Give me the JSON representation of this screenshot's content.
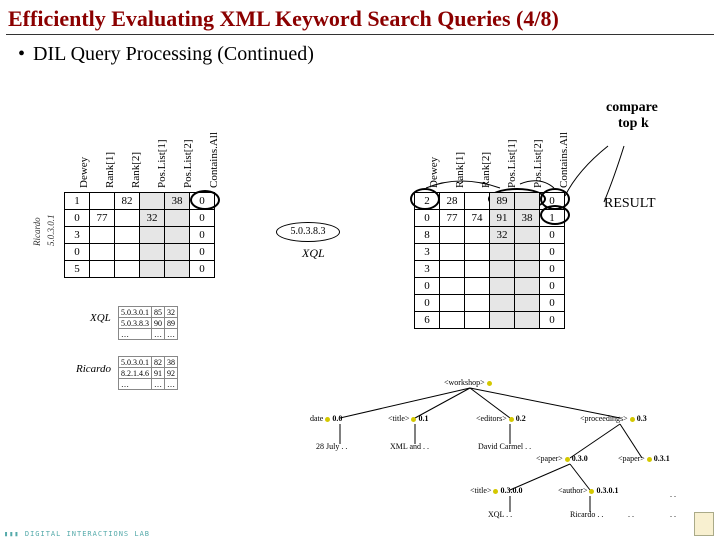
{
  "title": "Efficiently Evaluating XML Keyword Search Queries (4/8)",
  "bullet": "DIL Query Processing (Continued)",
  "headers": [
    "Dewey",
    "Rank[1]",
    "Rank[2]",
    "Pos.List[1]",
    "Pos.List[2]",
    "Contains.All"
  ],
  "right_labels": {
    "compare": "compare",
    "topk": "top k",
    "result": "RESULT"
  },
  "left_table": {
    "rows": [
      [
        "1",
        "",
        "82",
        "",
        "38",
        "0"
      ],
      [
        "0",
        "77",
        "",
        "32",
        "",
        "0"
      ],
      [
        "3",
        "",
        "",
        "",
        "",
        "0"
      ],
      [
        "0",
        "",
        "",
        "",
        "",
        "0"
      ],
      [
        "5",
        "",
        "",
        "",
        "",
        "0"
      ]
    ],
    "shaded_cols": [
      3,
      4
    ]
  },
  "right_table": {
    "rows": [
      [
        "2",
        "28",
        "",
        "89",
        "",
        "0"
      ],
      [
        "0",
        "77",
        "74",
        "91",
        "38",
        "1"
      ],
      [
        "8",
        "",
        "",
        "32",
        "",
        "0"
      ],
      [
        "3",
        "",
        "",
        "",
        "",
        "0"
      ],
      [
        "3",
        "",
        "",
        "",
        "",
        "0"
      ],
      [
        "0",
        "",
        "",
        "",
        "",
        "0"
      ],
      [
        "0",
        "",
        "",
        "",
        "",
        "0"
      ],
      [
        "6",
        "",
        "",
        "",
        "",
        "0"
      ]
    ],
    "shaded_cols": [
      3,
      4
    ]
  },
  "mid_oval": "5.0.3.8.3",
  "mid_label": "XQL",
  "side_labels": {
    "num": "5.0.3.0.1",
    "name": "Ricardo"
  },
  "mini_tables": {
    "xql": {
      "caption": "XQL",
      "rows": [
        [
          "5.0.3.0.1",
          "85",
          "32"
        ],
        [
          "5.0.3.8.3",
          "90",
          "89"
        ],
        [
          "…",
          "…",
          "…"
        ]
      ]
    },
    "ricardo": {
      "caption": "Ricardo",
      "rows": [
        [
          "5.0.3.0.1",
          "82",
          "38"
        ],
        [
          "8.2.1.4.6",
          "91",
          "92"
        ],
        [
          "…",
          "…",
          "…"
        ]
      ]
    }
  },
  "tree": {
    "root": "<workshop>",
    "n_date_l": "date",
    "n_date_v": "0.0",
    "n_title1": "<title>",
    "n_title1_v": "0.1",
    "n_editors": "<editors>",
    "n_editors_v": "0.2",
    "n_proc": "<proceedings>",
    "n_proc_v": "0.3",
    "n_28july": "28 July . .",
    "n_xmland": "XML and . .",
    "n_david": "David Carmel . .",
    "n_paper1": "<paper>",
    "n_paper1_v": "0.3.0",
    "n_paper2": "<paper>",
    "n_paper2_v": "0.3.1",
    "n_title2": "<title>",
    "n_title2_v": "0.3.0.0",
    "n_author": "<author>",
    "n_author_v": "0.3.0.1",
    "n_xql": "XQL . .",
    "n_ricardo": "Ricardo . .",
    "dots": ".  .",
    "dots2": ".  ."
  },
  "footer": "▮▮▮ DIGITAL INTERACTIONS LAB"
}
